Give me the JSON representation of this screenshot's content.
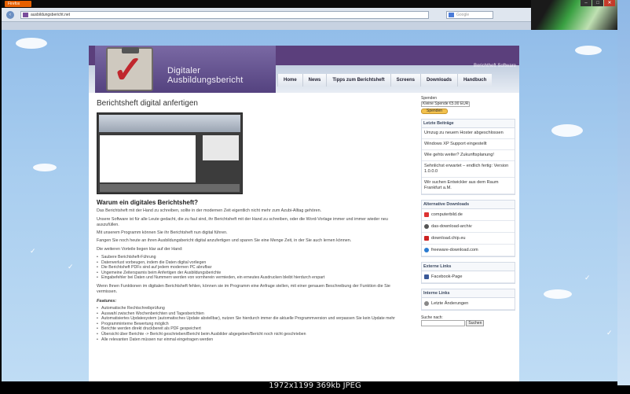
{
  "browser": {
    "firefox_label": "Firefox",
    "url": "ausbildungsbericht.net",
    "search_placeholder": "Google",
    "win_min": "–",
    "win_max": "□",
    "win_close": "✕"
  },
  "site": {
    "logo_text": "Digitaler Ausbildungsbericht",
    "header_right": "Berichtheft Software",
    "menu": [
      "Home",
      "News",
      "Tipps zum Berichtsheft",
      "Screens",
      "Downloads",
      "Handbuch"
    ]
  },
  "main": {
    "title": "Berichtsheft digital anfertigen",
    "heading": "Warum ein digitales Berichtsheft?",
    "paragraphs": [
      "Das Berichtsheft mit der Hand zu schreiben, sollte in der modernen Zeit eigentlich nicht mehr zum Azubi-Alltag gehören.",
      "Unsere Software ist für alle Leute gedacht, die zu faul sind, ihr Berichtsheft mit der Hand zu schreiben, oder die Word-Vorlage immer und immer wieder neu auszufüllen.",
      "Mit unserem Programm können Sie ihr Berichtsheft nun digital führen.",
      "Fangen Sie noch heute an ihren Ausbildungsbericht digital anzufertigen und sparen Sie eine Menge Zeit, in der Sie auch lernen können.",
      "Die weiteren Vorteile liegen klar auf der Hand:"
    ],
    "advantages": [
      "Saubere Berichtsheft-Führung",
      "Datenverlust vorbeugen, indem die Daten digital vorliegen",
      "Die Berichtsheft PDFs sind auf jedem modernen PC abrufbar",
      "Ungemeine Zeitersparnis beim Anfertigen der Ausbildungsberichte",
      "Eingabefehler bei Daten und Nummern werden von vornherein vermieden, ein erneutes Ausdrucken bleibt hierdurch erspart"
    ],
    "closing": "Wenn Ihnen Funktionen im digitalen Berichtsheft fehlen, können sie im Programm eine Anfrage stellen, mit einer genauen Beschreibung der Funktion die Sie vermissen.",
    "features_label": "Features:",
    "features": [
      "Automatische Rechtschreibprüfung",
      "Auswahl zwischen Wochenberichten und Tagesberichten",
      "Automatisiertes Updatesystem (automatisches Update abstellbar), nutzen Sie hierdurch immer die aktuelle Programmversion und verpassen Sie kein Update mehr",
      "Programminterne Bewertung möglich",
      "Berichte werden direkt druckbereit als PDF gespeichert",
      "Übersicht über Berichte -> Bericht geschrieben/Bericht beim Ausbilder abgegeben/Bericht noch nicht geschrieben",
      "Alle relevanten Daten müssen nur einmal eingetragen werden"
    ]
  },
  "sidebar": {
    "spenden_label": "Spenden",
    "select_value": "Kleine Spende €5.00 EUR",
    "spenden_button": "Spenden",
    "recent_title": "Letzte Beiträge",
    "recent_posts": [
      "Umzug zu neuem Hoster abgeschlossen",
      "Windows XP Support eingestellt",
      "Wie gehts weiter? Zukunftsplanung!",
      "Sehnlichst erwartet – endlich fertig: Version 1.0.0.0",
      "Wir suchen Entwickler aus dem Raum Frankfurt a.M."
    ],
    "downloads_title": "Alternative Downloads",
    "downloads": [
      "computerbild.de",
      "das-download-archiv",
      "download.chip.eu",
      "freeware-download.com"
    ],
    "external_title": "Externe Links",
    "external": [
      "Facebook-Page"
    ],
    "internal_title": "Interne Links",
    "internal": [
      "Letzte Änderungen"
    ],
    "search_label": "Suche nach:",
    "search_button": "Suchen"
  },
  "caption": "1972x1199  369kb  JPEG",
  "colors": {
    "header_purple": "#5b3f7c",
    "check_red": "#c0272d",
    "sky": "#a8cdef"
  }
}
